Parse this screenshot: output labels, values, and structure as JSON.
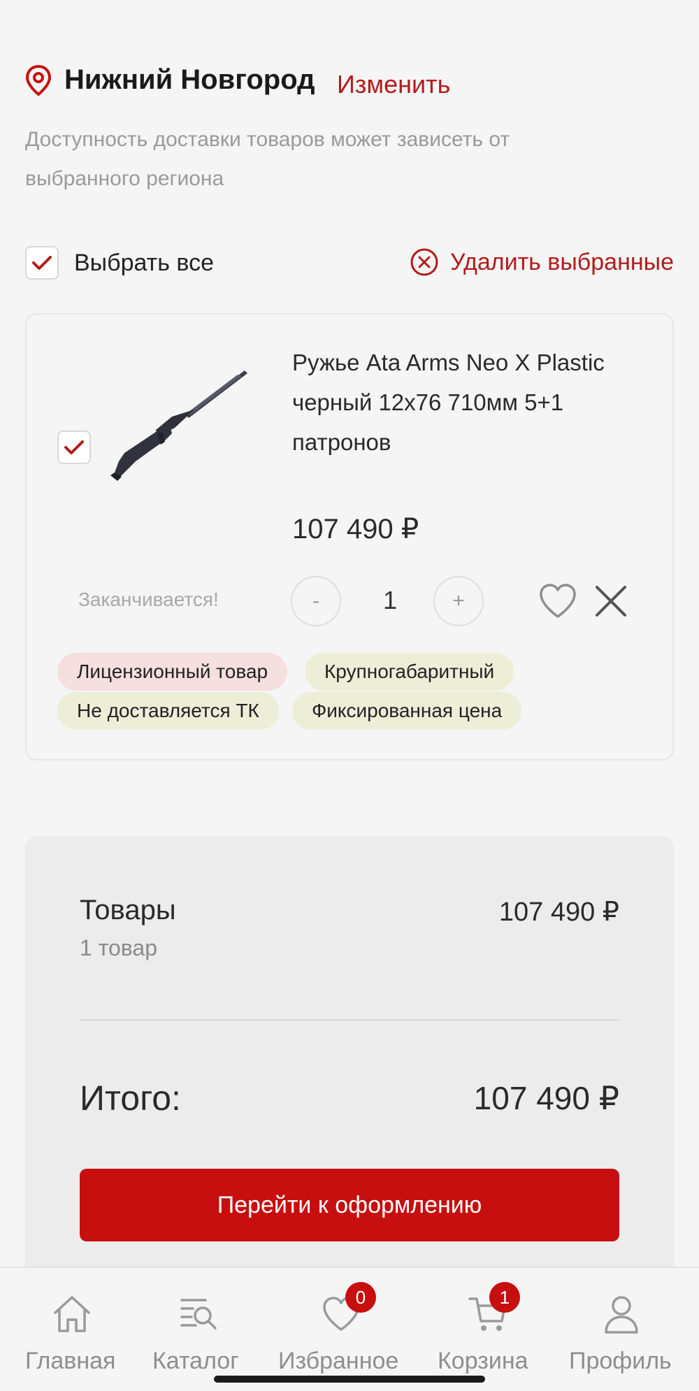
{
  "region": {
    "city": "Нижний Новгород",
    "change_label": "Изменить",
    "note": "Доступность доставки товаров может зависеть от выбранного региона"
  },
  "selection": {
    "select_all_label": "Выбрать все",
    "select_all_checked": true,
    "delete_selected_label": "Удалить выбранные"
  },
  "cart_item": {
    "checked": true,
    "title": "Ружье Ata Arms Neo X Plastic черный 12х76 710мм 5+1 патронов",
    "price": "107 490 ₽",
    "stock_note": "Заканчивается!",
    "qty_minus": "-",
    "quantity": "1",
    "qty_plus": "+",
    "tags": [
      {
        "label": "Лицензионный товар",
        "color": "#f6dfdf"
      },
      {
        "label": "Крупногабаритный",
        "color": "#eceed8"
      },
      {
        "label": "Не доставляется ТК",
        "color": "#eceed8"
      },
      {
        "label": "Фиксированная цена",
        "color": "#eceed8"
      }
    ]
  },
  "summary": {
    "goods_label": "Товары",
    "goods_value": "107 490 ₽",
    "goods_count": "1 товар",
    "total_label": "Итого:",
    "total_value": "107 490 ₽",
    "checkout_label": "Перейти к оформлению"
  },
  "bottom_nav": {
    "items": [
      {
        "label": "Главная",
        "icon": "home-icon"
      },
      {
        "label": "Каталог",
        "icon": "catalog-search-icon"
      },
      {
        "label": "Избранное",
        "icon": "heart-icon",
        "badge": "0"
      },
      {
        "label": "Корзина",
        "icon": "cart-icon",
        "badge": "1"
      },
      {
        "label": "Профиль",
        "icon": "profile-icon"
      }
    ]
  },
  "colors": {
    "accent": "#c70f0f",
    "link": "#b31b1b",
    "background": "#f5f5f5"
  }
}
